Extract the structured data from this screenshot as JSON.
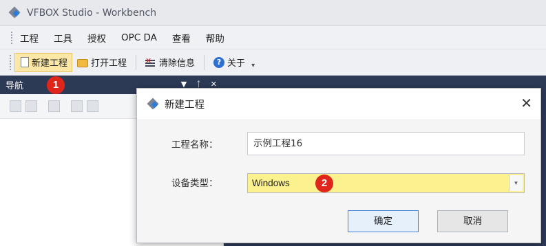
{
  "window": {
    "title": "VFBOX Studio - Workbench"
  },
  "menu": {
    "items": [
      "工程",
      "工具",
      "授权",
      "OPC DA",
      "查看",
      "帮助"
    ]
  },
  "toolbar": {
    "new_project": "新建工程",
    "open_project": "打开工程",
    "clear_info": "清除信息",
    "about": "关于"
  },
  "nav": {
    "title": "导航",
    "pin": "ᛏ",
    "close": "✕",
    "menu": "▼"
  },
  "badges": {
    "one": "1",
    "two": "2"
  },
  "dialog": {
    "title": "新建工程",
    "close": "✕",
    "project_name_label": "工程名称：",
    "project_name_value": "示例工程16",
    "device_type_label": "设备类型：",
    "device_type_value": "Windows",
    "ok": "确定",
    "cancel": "取消"
  },
  "colors": {
    "nav_header": "#2d3a56",
    "highlight": "#fbf18f",
    "badge": "#e0261b",
    "active_tool": "#fbe8a6"
  },
  "icons": [
    "app-logo-icon",
    "new-file-icon",
    "open-folder-icon",
    "clear-info-icon",
    "about-icon",
    "pin-icon",
    "close-icon",
    "dropdown-arrow-icon"
  ]
}
